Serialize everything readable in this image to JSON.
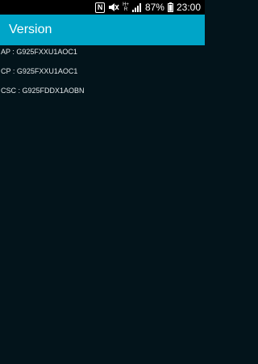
{
  "status_bar": {
    "network_label_top": "H+",
    "network_label_bottom": "R",
    "battery_percent": "87%",
    "time": "23:00"
  },
  "app_bar": {
    "title": "Version"
  },
  "versions": [
    {
      "text": "AP : G925FXXU1AOC1"
    },
    {
      "text": "CP : G925FXXU1AOC1"
    },
    {
      "text": "CSC : G925FDDX1AOBN"
    }
  ],
  "colors": {
    "app_bar": "#00a5c8",
    "background": "#03141b",
    "status_bar": "#000000",
    "text": "#e3e7e9"
  },
  "icons": [
    "nfc-icon",
    "mute-icon",
    "signal-icon",
    "battery-icon"
  ]
}
